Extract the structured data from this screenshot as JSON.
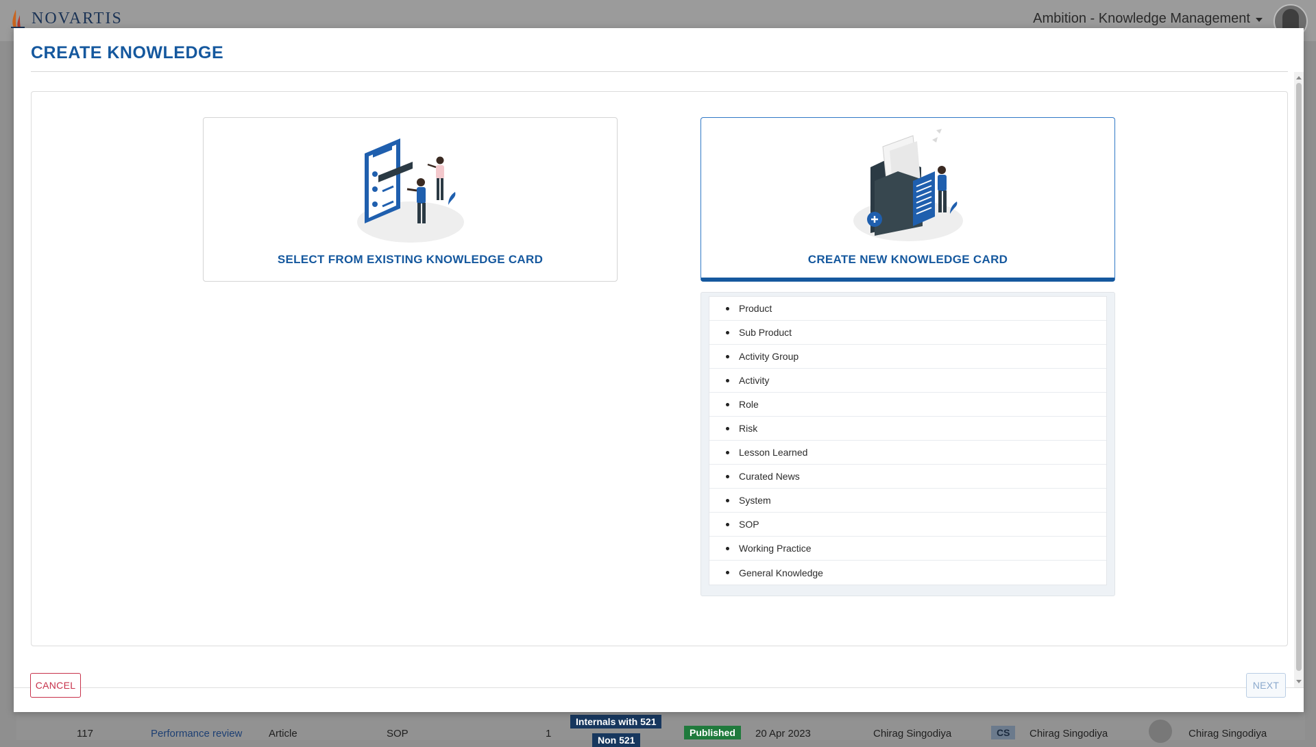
{
  "background": {
    "logo_text": "NOVARTIS",
    "app_name": "Ambition - Knowledge Management",
    "row": {
      "id": "117",
      "title": "Performance review",
      "type": "Article",
      "category": "SOP",
      "count": "1",
      "audience": "Internals with 521",
      "audience_cut": "Non 521",
      "status": "Published",
      "date": "20 Apr 2023",
      "author": "Chirag Singodiya",
      "initials": "CS",
      "owner": "Chirag Singodiya",
      "approver": "Chirag Singodiya"
    }
  },
  "modal": {
    "title": "CREATE KNOWLEDGE",
    "options": [
      {
        "label": "SELECT FROM EXISTING KNOWLEDGE CARD"
      },
      {
        "label": "CREATE NEW KNOWLEDGE CARD"
      }
    ],
    "types": [
      "Product",
      "Sub Product",
      "Activity Group",
      "Activity",
      "Role",
      "Risk",
      "Lesson Learned",
      "Curated News",
      "System",
      "SOP",
      "Working Practice",
      "General Knowledge"
    ],
    "cancel_label": "CANCEL",
    "next_label": "NEXT"
  },
  "colors": {
    "accent": "#15589e",
    "cancel": "#c7304a",
    "overlay": "#8f8f8f"
  }
}
